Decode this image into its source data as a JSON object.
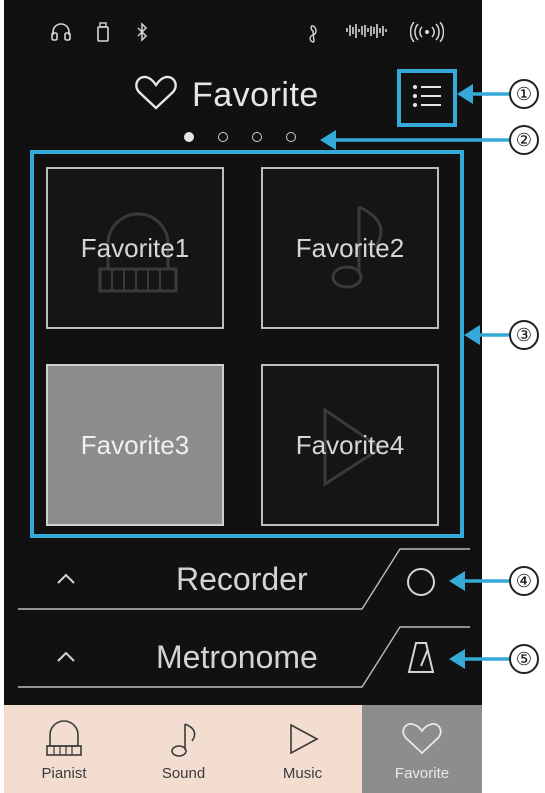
{
  "header": {
    "title": "Favorite",
    "icon": "heart-icon"
  },
  "status_icons": [
    "headphones-icon",
    "usb-icon",
    "bluetooth-icon",
    "clef-icon",
    "waveform-icon",
    "wireless-icon"
  ],
  "pager": {
    "pages": 4,
    "active": 0
  },
  "favorites": [
    {
      "label": "Favorite1",
      "ghost": "piano-icon",
      "selected": false
    },
    {
      "label": "Favorite2",
      "ghost": "note-icon",
      "selected": false
    },
    {
      "label": "Favorite3",
      "ghost": "",
      "selected": true
    },
    {
      "label": "Favorite4",
      "ghost": "play-icon",
      "selected": false
    }
  ],
  "panels": {
    "recorder": {
      "label": "Recorder",
      "icon": "record-circle-icon"
    },
    "metronome": {
      "label": "Metronome",
      "icon": "metronome-icon"
    }
  },
  "tabs": [
    {
      "label": "Pianist",
      "icon": "piano-icon",
      "active": false
    },
    {
      "label": "Sound",
      "icon": "note-icon",
      "active": false
    },
    {
      "label": "Music",
      "icon": "play-icon",
      "active": false
    },
    {
      "label": "Favorite",
      "icon": "heart-icon",
      "active": true
    }
  ],
  "callouts": [
    "①",
    "②",
    "③",
    "④",
    "⑤"
  ],
  "colors": {
    "highlight": "#35a9d8",
    "screen_bg": "#111111",
    "tabbar_bg": "#f2ddd0",
    "tab_active_bg": "#8d8d8d",
    "tile_selected_bg": "#8c8c8c"
  }
}
